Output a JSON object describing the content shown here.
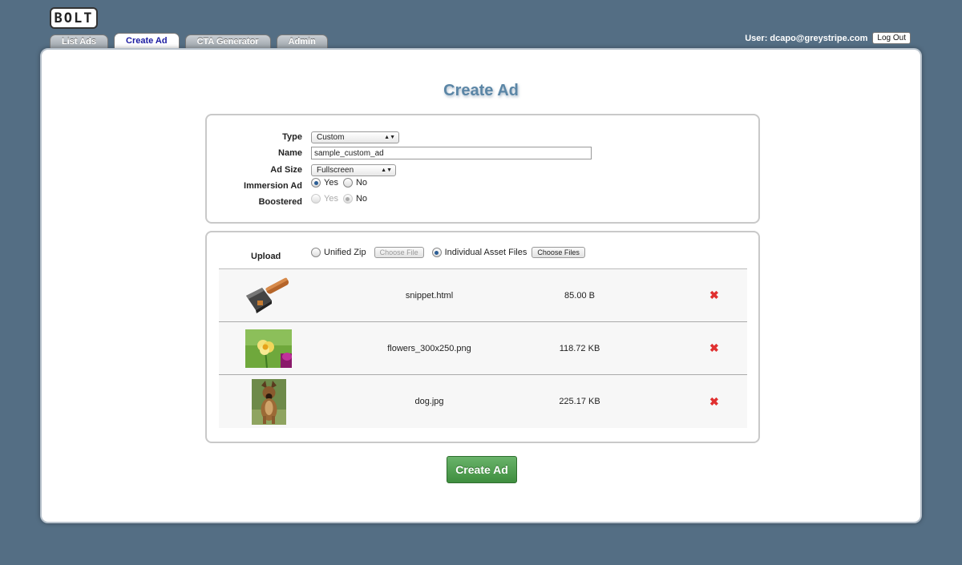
{
  "app": {
    "logo": "BOLT"
  },
  "tabs": [
    "List Ads",
    "Create Ad",
    "CTA Generator",
    "Admin"
  ],
  "user": {
    "label": "User: dcapo@greystripe.com",
    "logout": "Log Out"
  },
  "page": {
    "title": "Create Ad"
  },
  "form": {
    "type": {
      "label": "Type",
      "value": "Custom"
    },
    "name": {
      "label": "Name",
      "value": "sample_custom_ad"
    },
    "ad_size": {
      "label": "Ad Size",
      "value": "Fullscreen"
    },
    "immersion": {
      "label": "Immersion Ad",
      "yes": "Yes",
      "no": "No"
    },
    "boostered": {
      "label": "Boostered",
      "yes": "Yes",
      "no": "No"
    }
  },
  "upload": {
    "label": "Upload",
    "unified_zip": "Unified Zip",
    "choose_file": "Choose File",
    "individual": "Individual Asset Files",
    "choose_files": "Choose Files",
    "files": [
      {
        "name": "snippet.html",
        "size": "85.00 B",
        "icon": "hammer-icon"
      },
      {
        "name": "flowers_300x250.png",
        "size": "118.72 KB",
        "icon": "flower-thumbnail"
      },
      {
        "name": "dog.jpg",
        "size": "225.17 KB",
        "icon": "dog-thumbnail"
      }
    ],
    "delete_glyph": "✖"
  },
  "submit": {
    "label": "Create Ad"
  },
  "colors": {
    "background": "#546e84",
    "accent": "#5b86a6",
    "submit": "#4e9e4e",
    "delete": "#e03030"
  }
}
